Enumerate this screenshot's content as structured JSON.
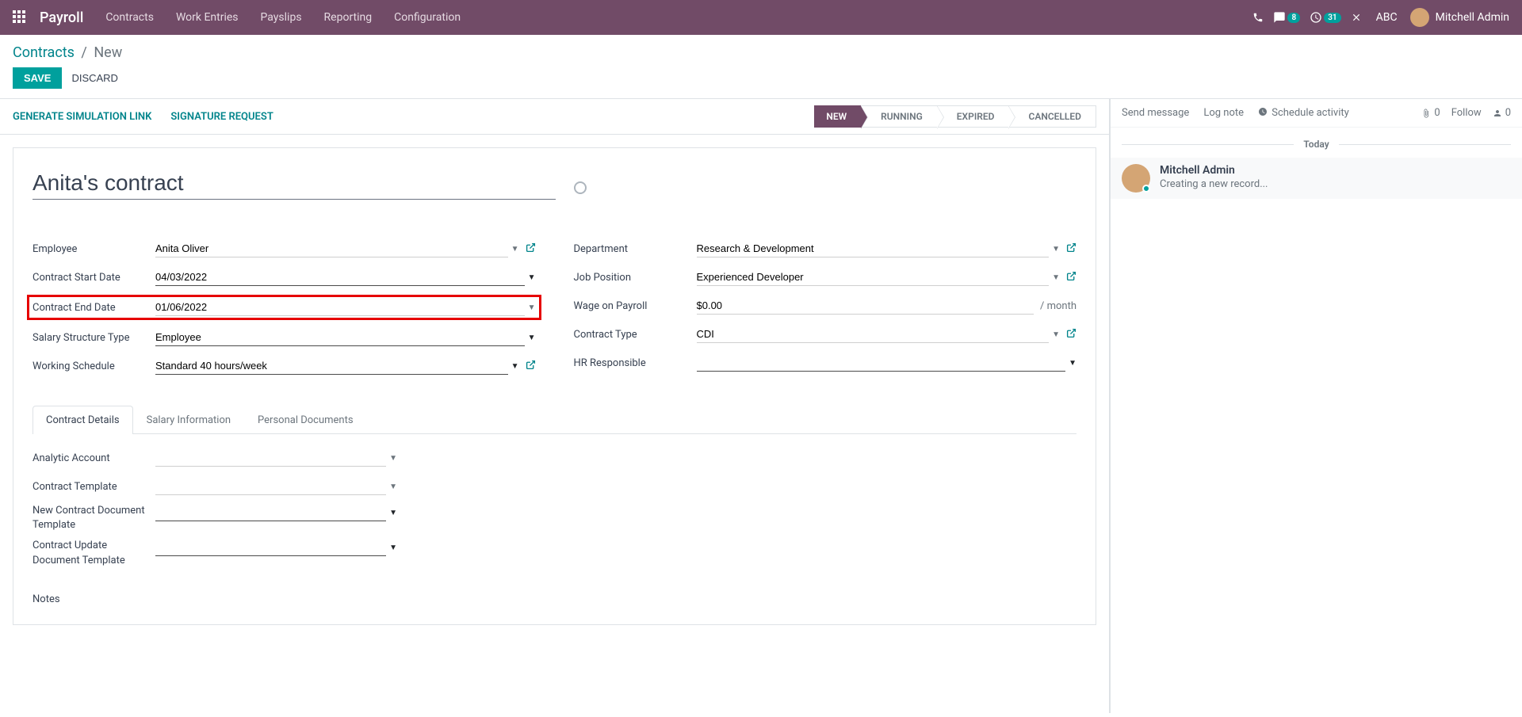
{
  "navbar": {
    "brand": "Payroll",
    "items": [
      "Contracts",
      "Work Entries",
      "Payslips",
      "Reporting",
      "Configuration"
    ],
    "chat_badge": "8",
    "activity_badge": "31",
    "company": "ABC",
    "user": "Mitchell Admin"
  },
  "breadcrumb": {
    "parent": "Contracts",
    "current": "New"
  },
  "buttons": {
    "save": "SAVE",
    "discard": "DISCARD"
  },
  "statusbar_actions": {
    "gen_sim": "GENERATE SIMULATION LINK",
    "sig_req": "SIGNATURE REQUEST"
  },
  "statusbar": {
    "new": "NEW",
    "running": "RUNNING",
    "expired": "EXPIRED",
    "cancelled": "CANCELLED"
  },
  "form": {
    "title": "Anita's contract",
    "labels": {
      "employee": "Employee",
      "start_date": "Contract Start Date",
      "end_date": "Contract End Date",
      "salary_type": "Salary Structure Type",
      "schedule": "Working Schedule",
      "department": "Department",
      "job": "Job Position",
      "wage": "Wage on Payroll",
      "wage_suffix": "/ month",
      "contract_type": "Contract Type",
      "hr_resp": "HR Responsible"
    },
    "values": {
      "employee": "Anita Oliver",
      "start_date": "04/03/2022",
      "end_date": "01/06/2022",
      "salary_type": "Employee",
      "schedule": "Standard 40 hours/week",
      "department": "Research & Development",
      "job": "Experienced Developer",
      "wage": "$0.00",
      "contract_type": "CDI",
      "hr_resp": ""
    }
  },
  "tabs": {
    "details": "Contract Details",
    "salary": "Salary Information",
    "docs": "Personal Documents"
  },
  "details_tab": {
    "labels": {
      "analytic": "Analytic Account",
      "template": "Contract Template",
      "new_doc": "New Contract Document Template",
      "update_doc": "Contract Update Document Template",
      "notes": "Notes"
    }
  },
  "chatter": {
    "send": "Send message",
    "log": "Log note",
    "schedule": "Schedule activity",
    "attach_count": "0",
    "follow": "Follow",
    "follower_count": "0",
    "today": "Today",
    "message": {
      "author": "Mitchell Admin",
      "text": "Creating a new record..."
    }
  }
}
